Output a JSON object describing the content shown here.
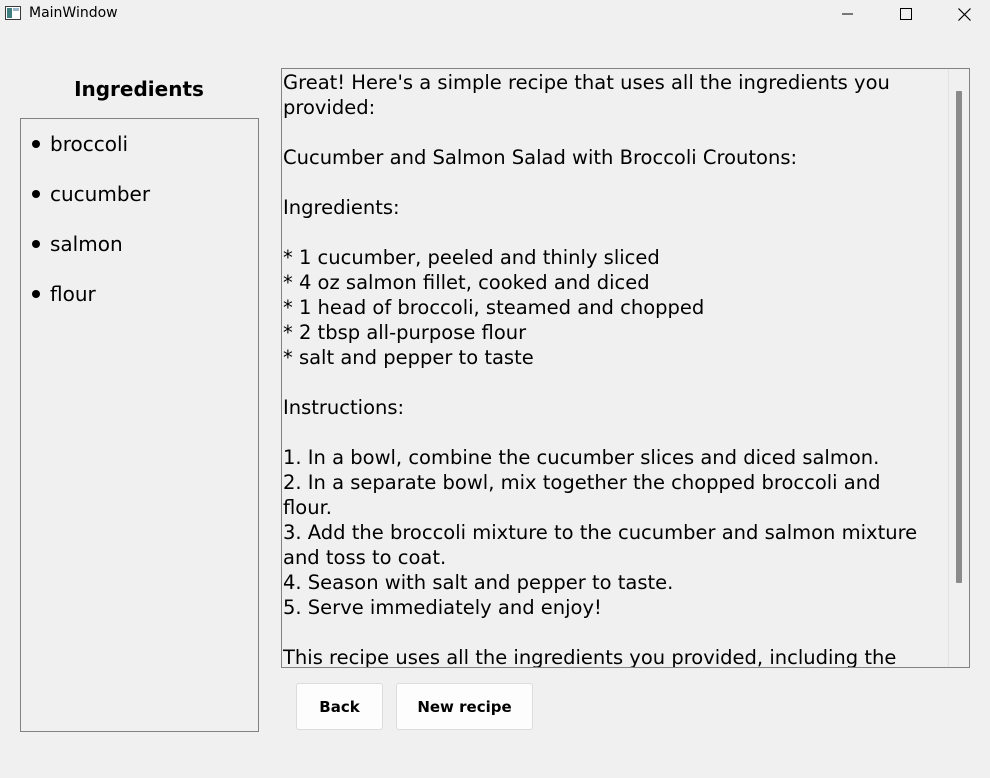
{
  "window": {
    "title": "MainWindow",
    "controls": [
      "minimize-icon",
      "maximize-icon",
      "close-icon"
    ]
  },
  "ingredients": {
    "heading": "Ingredients",
    "items": [
      "broccoli",
      "cucumber",
      "salmon",
      "flour"
    ]
  },
  "recipe": {
    "text": "Great! Here's a simple recipe that uses all the ingredients you\nprovided:\n\nCucumber and Salmon Salad with Broccoli Croutons:\n\nIngredients:\n\n* 1 cucumber, peeled and thinly sliced\n* 4 oz salmon fillet, cooked and diced\n* 1 head of broccoli, steamed and chopped\n* 2 tbsp all-purpose flour\n* salt and pepper to taste\n\nInstructions:\n\n1. In a bowl, combine the cucumber slices and diced salmon.\n2. In a separate bowl, mix together the chopped broccoli and\nflour.\n3. Add the broccoli mixture to the cucumber and salmon mixture\nand toss to coat.\n4. Season with salt and pepper to taste.\n5. Serve immediately and enjoy!\n\nThis recipe uses all the ingredients you provided, including the"
  },
  "buttons": {
    "back_label": "Back",
    "new_recipe_label": "New recipe"
  }
}
